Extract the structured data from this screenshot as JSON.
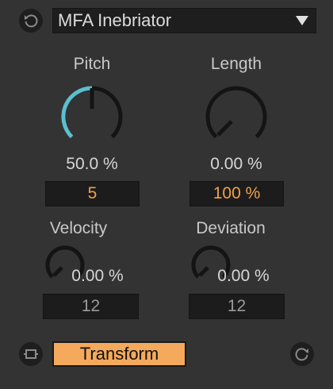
{
  "header": {
    "reset_icon": "reset-icon",
    "preset_name": "MFA Inebriator",
    "dropdown_icon": "chevron-down-icon"
  },
  "pitch": {
    "label": "Pitch",
    "readout": "50.0 %",
    "value_box": "5",
    "level": 0.5
  },
  "length": {
    "label": "Length",
    "readout": "0.00 %",
    "value_box": "100 %",
    "level": 0.0
  },
  "velocity": {
    "label": "Velocity",
    "readout": "0.00 %",
    "value_box": "12",
    "level": 0.0
  },
  "deviation": {
    "label": "Deviation",
    "readout": "0.00 %",
    "value_box": "12",
    "level": 0.0
  },
  "footer": {
    "link_icon": "link-icon",
    "transform_label": "Transform",
    "refresh_icon": "refresh-icon"
  },
  "colors": {
    "background": "#333333",
    "accent_knob": "#5bbfcf",
    "active_value": "#f2a04a",
    "transform_button": "#f4a95c"
  }
}
